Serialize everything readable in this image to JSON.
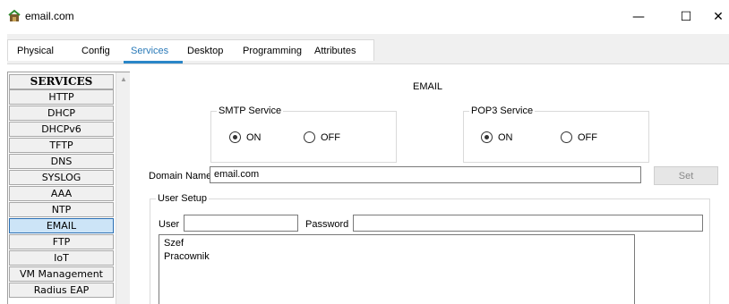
{
  "window": {
    "title": "email.com",
    "minimize_glyph": "—",
    "maximize_glyph": "☐",
    "close_glyph": "✕",
    "icon": "network-device-icon"
  },
  "tabs": [
    {
      "label": "Physical",
      "active": false
    },
    {
      "label": "Config",
      "active": false
    },
    {
      "label": "Services",
      "active": true
    },
    {
      "label": "Desktop",
      "active": false
    },
    {
      "label": "Programming",
      "active": false
    },
    {
      "label": "Attributes",
      "active": false
    }
  ],
  "services": {
    "header": "SERVICES",
    "items": [
      "HTTP",
      "DHCP",
      "DHCPv6",
      "TFTP",
      "DNS",
      "SYSLOG",
      "AAA",
      "NTP",
      "EMAIL",
      "FTP",
      "IoT",
      "VM Management",
      "Radius EAP"
    ],
    "selected": "EMAIL"
  },
  "email": {
    "title": "EMAIL",
    "smtp": {
      "legend": "SMTP Service",
      "on_label": "ON",
      "off_label": "OFF",
      "value": "ON"
    },
    "pop3": {
      "legend": "POP3 Service",
      "on_label": "ON",
      "off_label": "OFF",
      "value": "ON"
    },
    "domain_label": "Domain Name:",
    "domain_value": "email.com",
    "set_label": "Set",
    "user_setup": {
      "legend": "User Setup",
      "user_label": "User",
      "user_value": "",
      "password_label": "Password",
      "password_value": "",
      "users": [
        "Szef",
        "Pracownik"
      ]
    }
  },
  "colors": {
    "accent": "#2a86c8",
    "selected_bg": "#cce4f7",
    "disabled_text": "#8a8a8a"
  }
}
